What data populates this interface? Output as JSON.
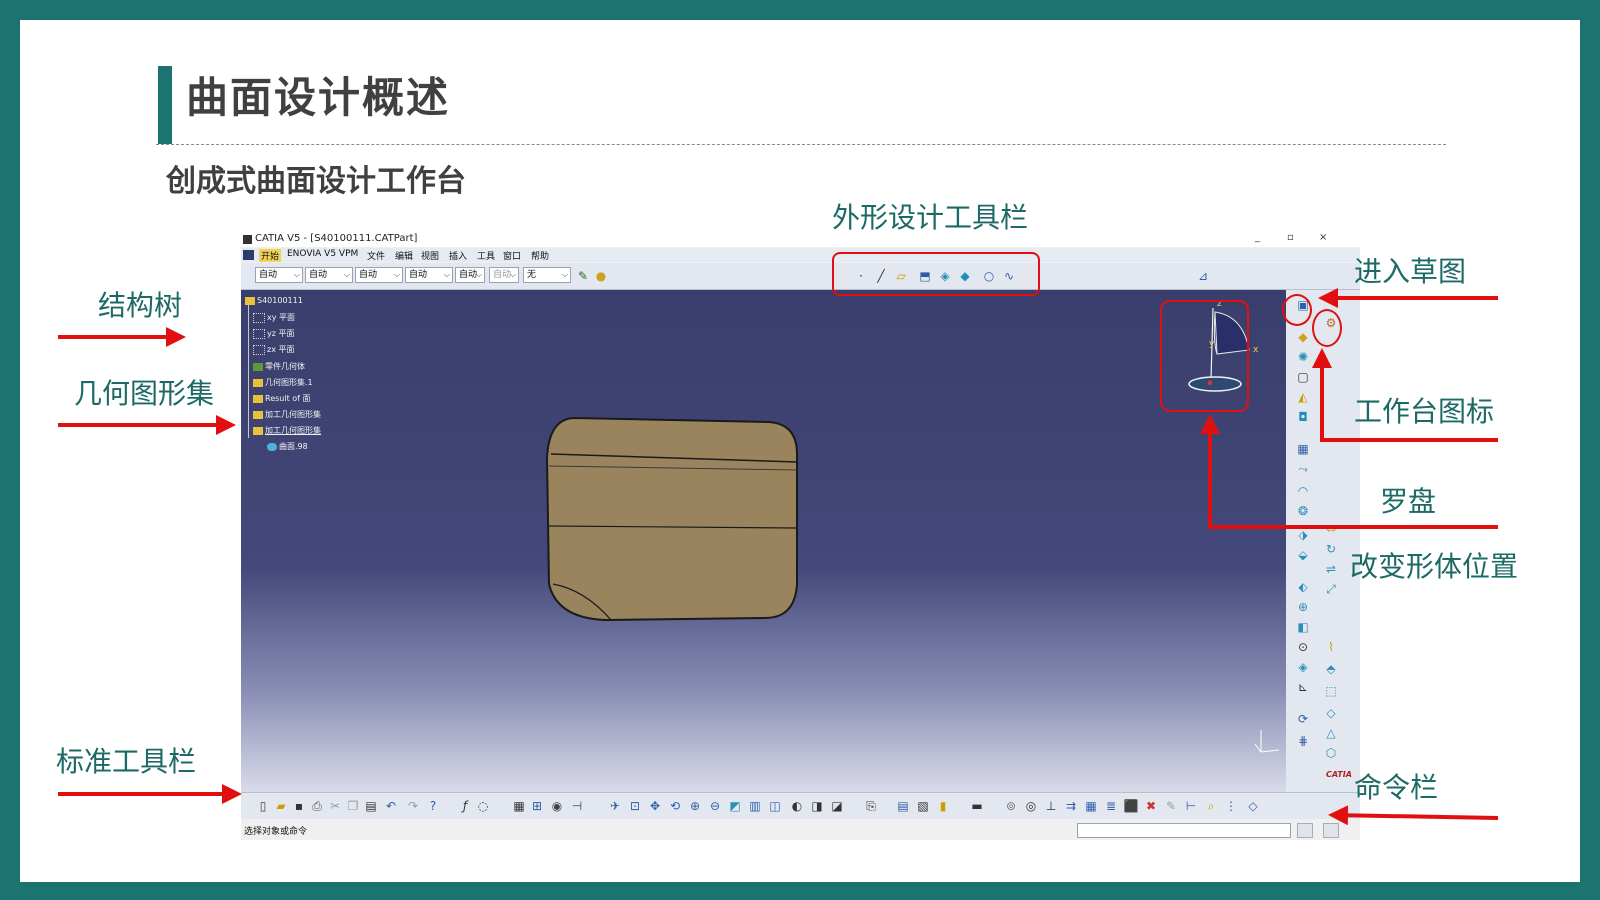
{
  "slide": {
    "title": "曲面设计概述",
    "subtitle": "创成式曲面设计工作台"
  },
  "catia_window": {
    "title": "CATIA V5 - [S40100111.CATPart]",
    "window_controls": [
      "_",
      "▫",
      "×"
    ],
    "menu": [
      "开始",
      "ENOVIA V5 VPM",
      "文件",
      "编辑",
      "视图",
      "插入",
      "工具",
      "窗口",
      "帮助"
    ],
    "combos": [
      {
        "value": "自动"
      },
      {
        "value": "自动"
      },
      {
        "value": "自动"
      },
      {
        "value": "自动"
      },
      {
        "value": "自动"
      },
      {
        "value": "自动"
      },
      {
        "value": "无"
      }
    ],
    "tree": [
      {
        "label": "S40100111"
      },
      {
        "label": "xy 平面"
      },
      {
        "label": "yz 平面"
      },
      {
        "label": "zx 平面"
      },
      {
        "label": "零件几何体"
      },
      {
        "label": "几何图形集.1"
      },
      {
        "label": "Result of 面"
      },
      {
        "label": "加工几何图形集"
      },
      {
        "label": "加工几何图形集"
      },
      {
        "label": "曲面.98"
      }
    ],
    "compass_axes": [
      "z",
      "y",
      "x"
    ],
    "status_text": "选择对象或命令",
    "brand": "CATIA"
  },
  "annotations": {
    "shape_toolbar": "外形设计工具栏",
    "spec_tree": "结构树",
    "geometric_set": "几何图形集",
    "standard_toolbar": "标准工具栏",
    "enter_sketch": "进入草图",
    "workbench_icon": "工作台图标",
    "compass": "罗盘",
    "move_body": "改变形体位置",
    "command_bar": "命令栏"
  },
  "colors": {
    "frame": "#1c7470",
    "title_accent": "#1c7470",
    "annotation_text": "#1c6a66",
    "annotation_red": "#e01010",
    "viewport_top": "#3a3e6c",
    "model_fill": "#9a845e"
  }
}
